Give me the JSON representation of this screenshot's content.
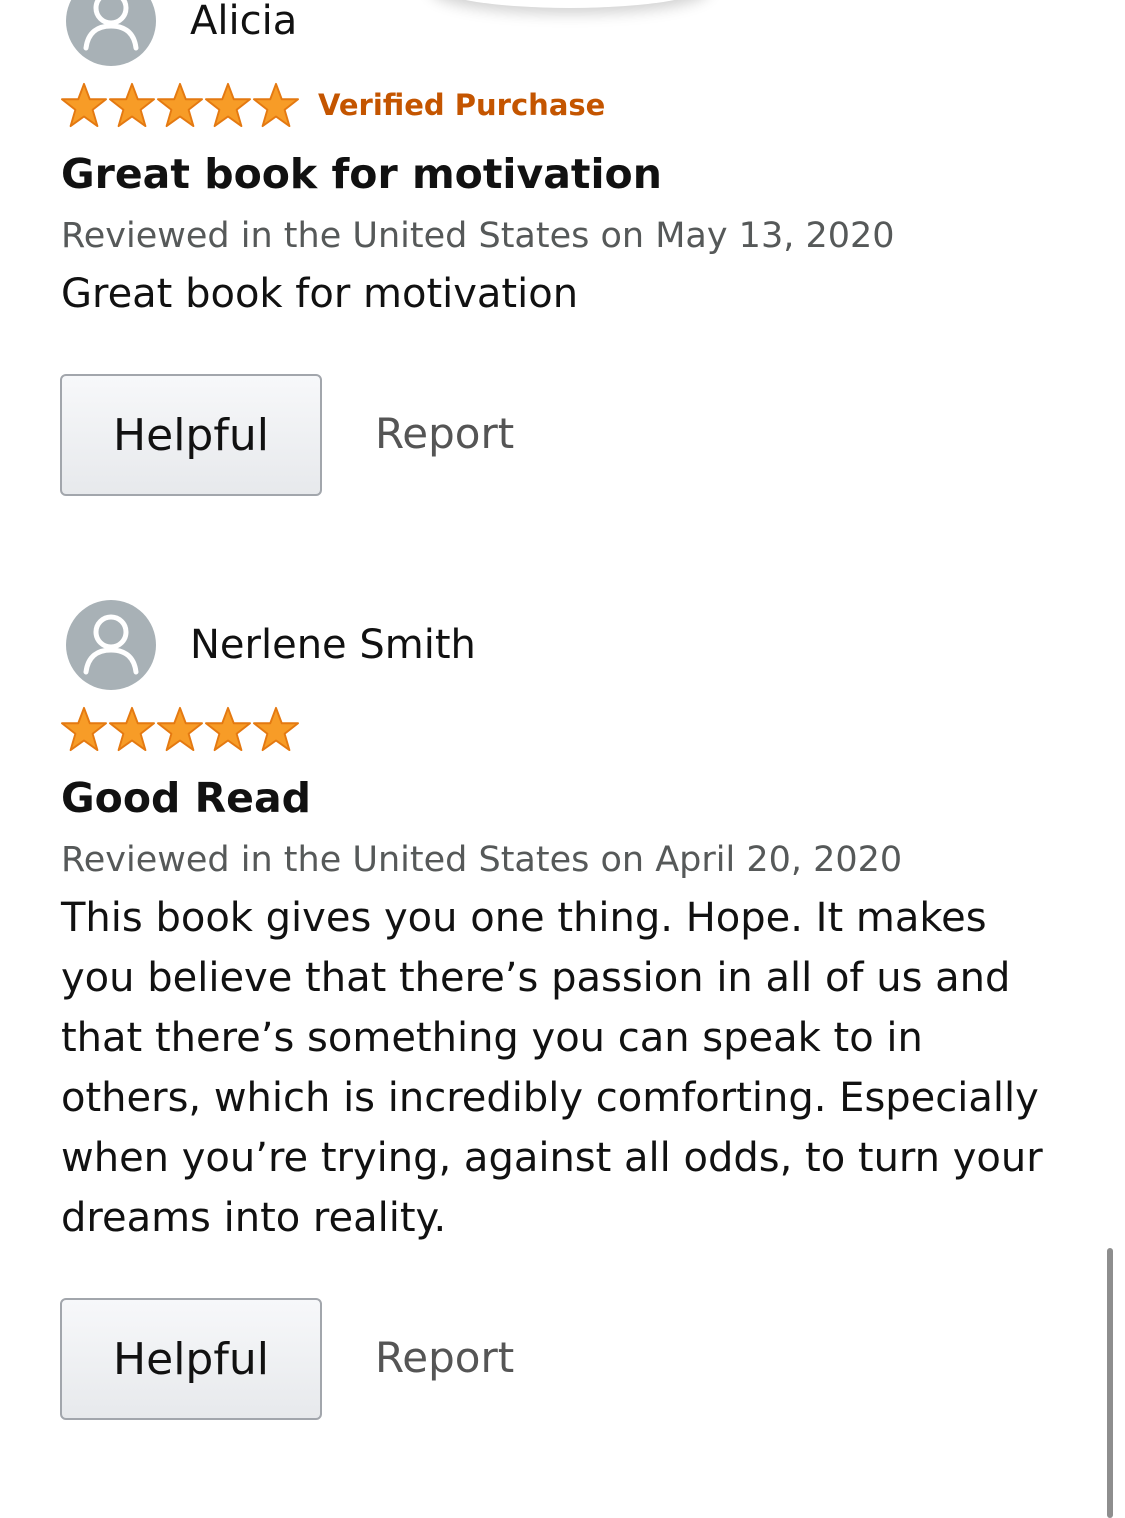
{
  "colors": {
    "star": "#f79c27",
    "star_stroke": "#e47911",
    "verified": "#c45500",
    "secondary_text": "#565959"
  },
  "reviews": [
    {
      "reviewer_name": "Alicia",
      "rating": 5,
      "verified_label": "Verified Purchase",
      "title": "Great book for motivation",
      "date_line": "Reviewed in the United States on May 13, 2020",
      "body": "Great book for motivation",
      "helpful_label": "Helpful",
      "report_label": "Report"
    },
    {
      "reviewer_name": "Nerlene Smith",
      "rating": 5,
      "title": "Good Read",
      "date_line": "Reviewed in the United States on April 20, 2020",
      "body": "This book gives you one thing. Hope. It makes you believe that there’s passion in all of us and that there’s something you can speak to in others, which is incredibly comforting. Especially when you’re trying, against all odds, to turn your dreams into reality.",
      "helpful_label": "Helpful",
      "report_label": "Report"
    }
  ]
}
